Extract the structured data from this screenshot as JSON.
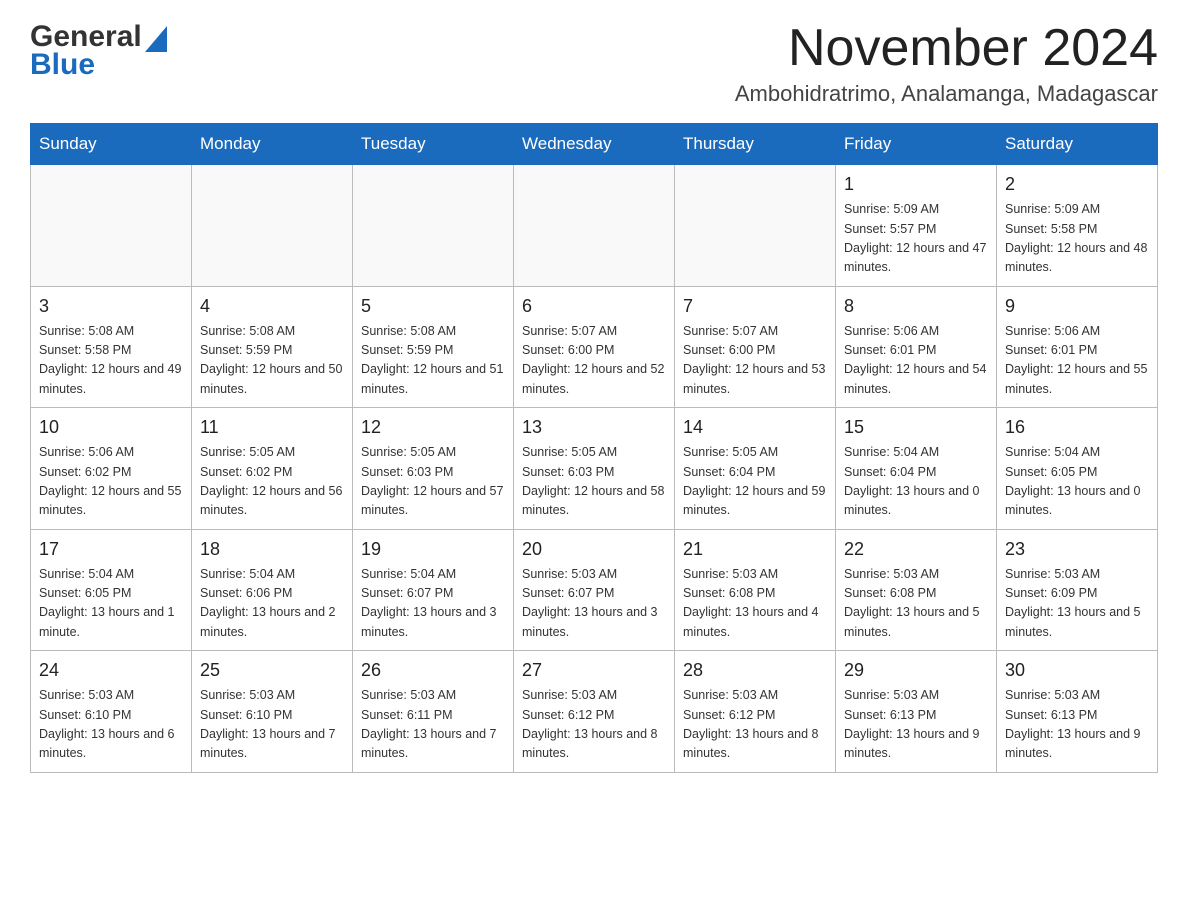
{
  "header": {
    "logo_general": "General",
    "logo_blue": "Blue",
    "month_title": "November 2024",
    "location": "Ambohidratrimo, Analamanga, Madagascar"
  },
  "weekdays": [
    "Sunday",
    "Monday",
    "Tuesday",
    "Wednesday",
    "Thursday",
    "Friday",
    "Saturday"
  ],
  "weeks": [
    [
      {
        "day": "",
        "info": ""
      },
      {
        "day": "",
        "info": ""
      },
      {
        "day": "",
        "info": ""
      },
      {
        "day": "",
        "info": ""
      },
      {
        "day": "",
        "info": ""
      },
      {
        "day": "1",
        "info": "Sunrise: 5:09 AM\nSunset: 5:57 PM\nDaylight: 12 hours and 47 minutes."
      },
      {
        "day": "2",
        "info": "Sunrise: 5:09 AM\nSunset: 5:58 PM\nDaylight: 12 hours and 48 minutes."
      }
    ],
    [
      {
        "day": "3",
        "info": "Sunrise: 5:08 AM\nSunset: 5:58 PM\nDaylight: 12 hours and 49 minutes."
      },
      {
        "day": "4",
        "info": "Sunrise: 5:08 AM\nSunset: 5:59 PM\nDaylight: 12 hours and 50 minutes."
      },
      {
        "day": "5",
        "info": "Sunrise: 5:08 AM\nSunset: 5:59 PM\nDaylight: 12 hours and 51 minutes."
      },
      {
        "day": "6",
        "info": "Sunrise: 5:07 AM\nSunset: 6:00 PM\nDaylight: 12 hours and 52 minutes."
      },
      {
        "day": "7",
        "info": "Sunrise: 5:07 AM\nSunset: 6:00 PM\nDaylight: 12 hours and 53 minutes."
      },
      {
        "day": "8",
        "info": "Sunrise: 5:06 AM\nSunset: 6:01 PM\nDaylight: 12 hours and 54 minutes."
      },
      {
        "day": "9",
        "info": "Sunrise: 5:06 AM\nSunset: 6:01 PM\nDaylight: 12 hours and 55 minutes."
      }
    ],
    [
      {
        "day": "10",
        "info": "Sunrise: 5:06 AM\nSunset: 6:02 PM\nDaylight: 12 hours and 55 minutes."
      },
      {
        "day": "11",
        "info": "Sunrise: 5:05 AM\nSunset: 6:02 PM\nDaylight: 12 hours and 56 minutes."
      },
      {
        "day": "12",
        "info": "Sunrise: 5:05 AM\nSunset: 6:03 PM\nDaylight: 12 hours and 57 minutes."
      },
      {
        "day": "13",
        "info": "Sunrise: 5:05 AM\nSunset: 6:03 PM\nDaylight: 12 hours and 58 minutes."
      },
      {
        "day": "14",
        "info": "Sunrise: 5:05 AM\nSunset: 6:04 PM\nDaylight: 12 hours and 59 minutes."
      },
      {
        "day": "15",
        "info": "Sunrise: 5:04 AM\nSunset: 6:04 PM\nDaylight: 13 hours and 0 minutes."
      },
      {
        "day": "16",
        "info": "Sunrise: 5:04 AM\nSunset: 6:05 PM\nDaylight: 13 hours and 0 minutes."
      }
    ],
    [
      {
        "day": "17",
        "info": "Sunrise: 5:04 AM\nSunset: 6:05 PM\nDaylight: 13 hours and 1 minute."
      },
      {
        "day": "18",
        "info": "Sunrise: 5:04 AM\nSunset: 6:06 PM\nDaylight: 13 hours and 2 minutes."
      },
      {
        "day": "19",
        "info": "Sunrise: 5:04 AM\nSunset: 6:07 PM\nDaylight: 13 hours and 3 minutes."
      },
      {
        "day": "20",
        "info": "Sunrise: 5:03 AM\nSunset: 6:07 PM\nDaylight: 13 hours and 3 minutes."
      },
      {
        "day": "21",
        "info": "Sunrise: 5:03 AM\nSunset: 6:08 PM\nDaylight: 13 hours and 4 minutes."
      },
      {
        "day": "22",
        "info": "Sunrise: 5:03 AM\nSunset: 6:08 PM\nDaylight: 13 hours and 5 minutes."
      },
      {
        "day": "23",
        "info": "Sunrise: 5:03 AM\nSunset: 6:09 PM\nDaylight: 13 hours and 5 minutes."
      }
    ],
    [
      {
        "day": "24",
        "info": "Sunrise: 5:03 AM\nSunset: 6:10 PM\nDaylight: 13 hours and 6 minutes."
      },
      {
        "day": "25",
        "info": "Sunrise: 5:03 AM\nSunset: 6:10 PM\nDaylight: 13 hours and 7 minutes."
      },
      {
        "day": "26",
        "info": "Sunrise: 5:03 AM\nSunset: 6:11 PM\nDaylight: 13 hours and 7 minutes."
      },
      {
        "day": "27",
        "info": "Sunrise: 5:03 AM\nSunset: 6:12 PM\nDaylight: 13 hours and 8 minutes."
      },
      {
        "day": "28",
        "info": "Sunrise: 5:03 AM\nSunset: 6:12 PM\nDaylight: 13 hours and 8 minutes."
      },
      {
        "day": "29",
        "info": "Sunrise: 5:03 AM\nSunset: 6:13 PM\nDaylight: 13 hours and 9 minutes."
      },
      {
        "day": "30",
        "info": "Sunrise: 5:03 AM\nSunset: 6:13 PM\nDaylight: 13 hours and 9 minutes."
      }
    ]
  ]
}
